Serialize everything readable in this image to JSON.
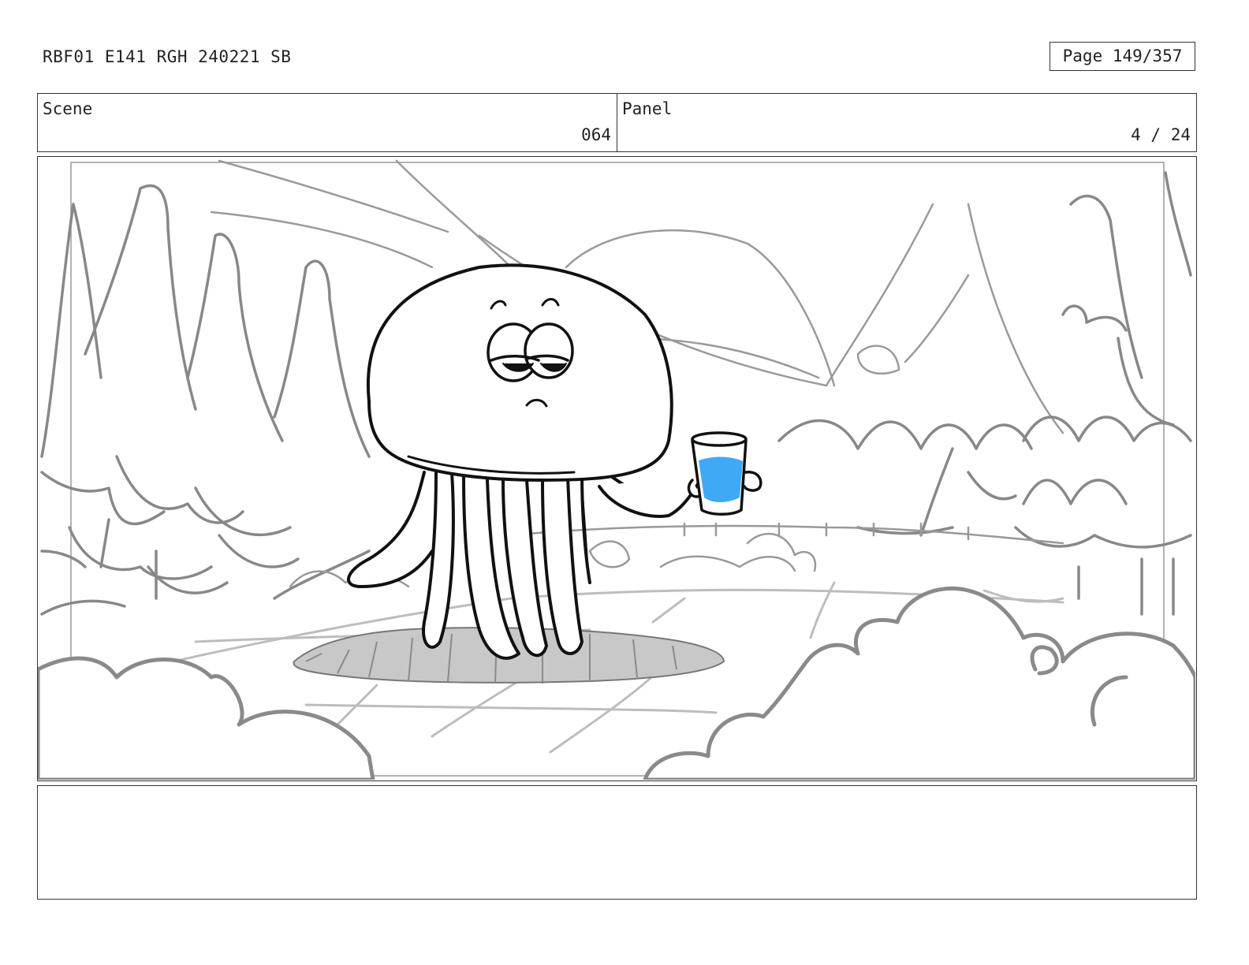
{
  "header": {
    "doc_id": "RBF01 E141 RGH 240221 SB",
    "page": "Page 149/357"
  },
  "scene": {
    "label": "Scene",
    "value": "064"
  },
  "panel": {
    "label": "Panel",
    "value": "4 / 24"
  },
  "notes": {
    "text": ""
  },
  "colors": {
    "water": "#3fa9f5",
    "sketch": "#888888",
    "ink": "#111111",
    "ground_patch": "#c8c8c8"
  }
}
